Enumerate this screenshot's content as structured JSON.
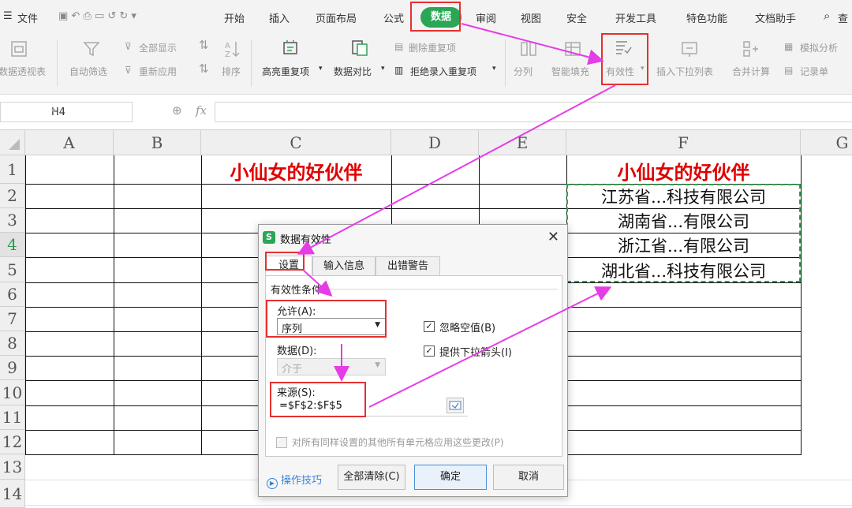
{
  "menu": {
    "file": "文件",
    "tabs": [
      "开始",
      "插入",
      "页面布局",
      "公式",
      "数据",
      "审阅",
      "视图",
      "安全",
      "开发工具",
      "特色功能",
      "文档助手"
    ],
    "active_tab": "数据",
    "search": "查"
  },
  "ribbon": {
    "pivot": "数据透视表",
    "autofilter": "自动筛选",
    "show_all": "全部显示",
    "reapply": "重新应用",
    "sort": "排序",
    "highlight_dup": "高亮重复项",
    "compare": "数据对比",
    "remove_dup": "删除重复项",
    "reject_dup": "拒绝录入重复项",
    "split": "分列",
    "smart_fill": "智能填充",
    "validity": "有效性",
    "dropdown_list": "插入下拉列表",
    "merge_calc": "合并计算",
    "simulate": "模拟分析",
    "record": "记录单"
  },
  "formula_bar": {
    "name_box": "H4",
    "fx": "fx"
  },
  "sheet": {
    "columns": [
      "A",
      "B",
      "C",
      "D",
      "E",
      "F",
      "G"
    ],
    "rows": [
      "1",
      "2",
      "3",
      "4",
      "5",
      "6",
      "7",
      "8",
      "9",
      "10",
      "11",
      "12",
      "13",
      "14"
    ],
    "c1": "小仙女的好伙伴",
    "f1": "小仙女的好伙伴",
    "f_list": [
      "江苏省...科技有限公司",
      "湖南省...有限公司",
      "浙江省...有限公司",
      "湖北省...科技有限公司"
    ]
  },
  "dialog": {
    "title": "数据有效性",
    "close": "✕",
    "tabs": [
      "设置",
      "输入信息",
      "出错警告"
    ],
    "group": "有效性条件",
    "allow_label": "允许(A):",
    "allow_value": "序列",
    "data_label": "数据(D):",
    "data_value": "介于",
    "ignore_blank": "忽略空值(B)",
    "dropdown_arrow": "提供下拉箭头(I)",
    "source_label": "来源(S):",
    "source_value": "=$F$2:$F$5",
    "apply_all": "对所有同样设置的其他所有单元格应用这些更改(P)",
    "tips": "操作技巧",
    "clear_all": "全部清除(C)",
    "ok": "确定",
    "cancel": "取消"
  },
  "colors": {
    "accent_green": "#2aa655",
    "annotation_red": "#e53030",
    "arrow_magenta": "#e63ce6",
    "title_red": "#e10000"
  }
}
